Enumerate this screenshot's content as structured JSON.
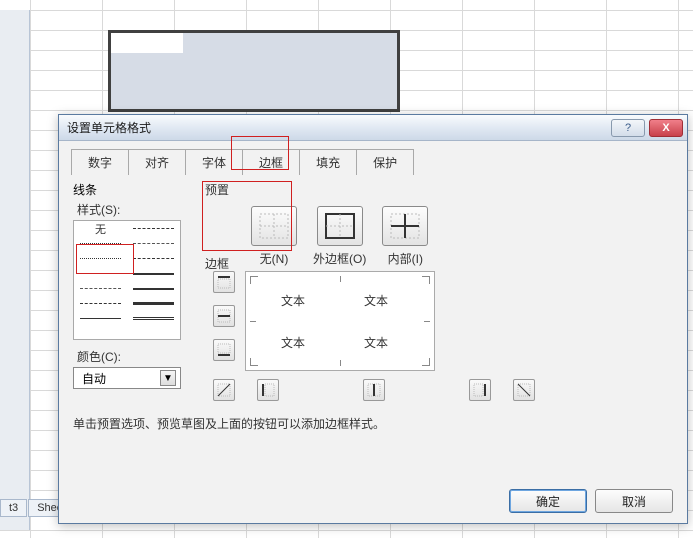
{
  "sheet": {
    "tabs": [
      "t3",
      "Shee"
    ]
  },
  "dialog": {
    "title": "设置单元格格式",
    "help_symbol": "?",
    "close_symbol": "X",
    "tabs": {
      "number": "数字",
      "alignment": "对齐",
      "font": "字体",
      "border": "边框",
      "fill": "填充",
      "protection": "保护"
    },
    "line": {
      "group": "线条",
      "style_label": "样式(S):",
      "none": "无",
      "color_label": "颜色(C):",
      "color_value": "自动",
      "dd_glyph": "▼"
    },
    "preset": {
      "label": "预置",
      "none": "无(N)",
      "outline": "外边框(O)",
      "inside": "内部(I)"
    },
    "border": {
      "label": "边框",
      "sample": "文本"
    },
    "helper": "单击预置选项、预览草图及上面的按钮可以添加边框样式。",
    "buttons": {
      "ok": "确定",
      "cancel": "取消"
    }
  }
}
